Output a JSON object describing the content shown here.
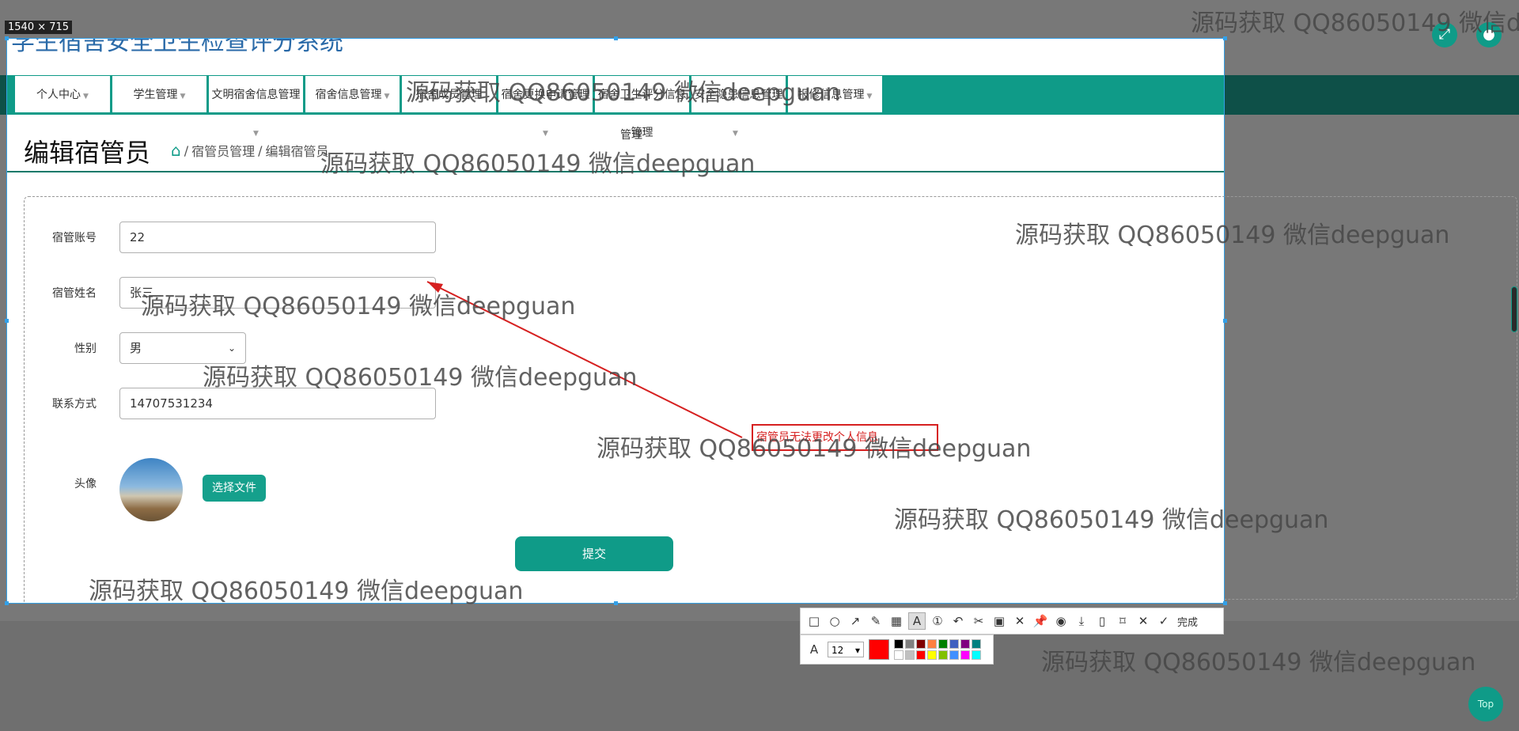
{
  "window": {
    "system_title": "学生宿舍安全卫生检查评分系统",
    "selection_size": "1540 × 715"
  },
  "nav": {
    "items": [
      {
        "label": "个人中心"
      },
      {
        "label": "学生管理"
      },
      {
        "label": "文明宿舍信息管理"
      },
      {
        "label": "宿舍信息管理"
      },
      {
        "label": "宿舍成员管理"
      },
      {
        "label": "宿舍更换申请管理"
      },
      {
        "label": "宿舍卫生评分信息管理"
      },
      {
        "label": "安全隐患信息管理"
      },
      {
        "label": "报修信息管理"
      }
    ],
    "wrapped_second_line": "管理"
  },
  "page": {
    "title": "编辑宿管员",
    "breadcrumb": {
      "home_icon": "home-icon",
      "separator": "/",
      "parent": "宿管员管理",
      "current": "编辑宿管员"
    }
  },
  "form": {
    "account_label": "宿管账号",
    "account_value": "22",
    "name_label": "宿管姓名",
    "name_value": "张三",
    "gender_label": "性别",
    "gender_value": "男",
    "contact_label": "联系方式",
    "contact_value": "14707531234",
    "avatar_label": "头像",
    "choose_file_label": "选择文件",
    "submit_label": "提交"
  },
  "annotation": {
    "note": "宿管员无法更改个人信息",
    "color": "#d62020"
  },
  "toolbar": {
    "done_label": "完成",
    "font_size": "12",
    "current_color": "#ff0000",
    "palette": [
      "#000000",
      "#808080",
      "#800000",
      "#ff8040",
      "#008000",
      "#4060c0",
      "#800080",
      "#008080",
      "#ffffff",
      "#c0c0c0",
      "#ff0000",
      "#ffff00",
      "#80c000",
      "#4090ff",
      "#ff00ff",
      "#00ffff"
    ]
  },
  "watermark": "源码获取 QQ86050149 微信deepguan",
  "top_button": "Top",
  "colors": {
    "accent": "#0f9b88",
    "selection_border": "#33a0e8"
  }
}
